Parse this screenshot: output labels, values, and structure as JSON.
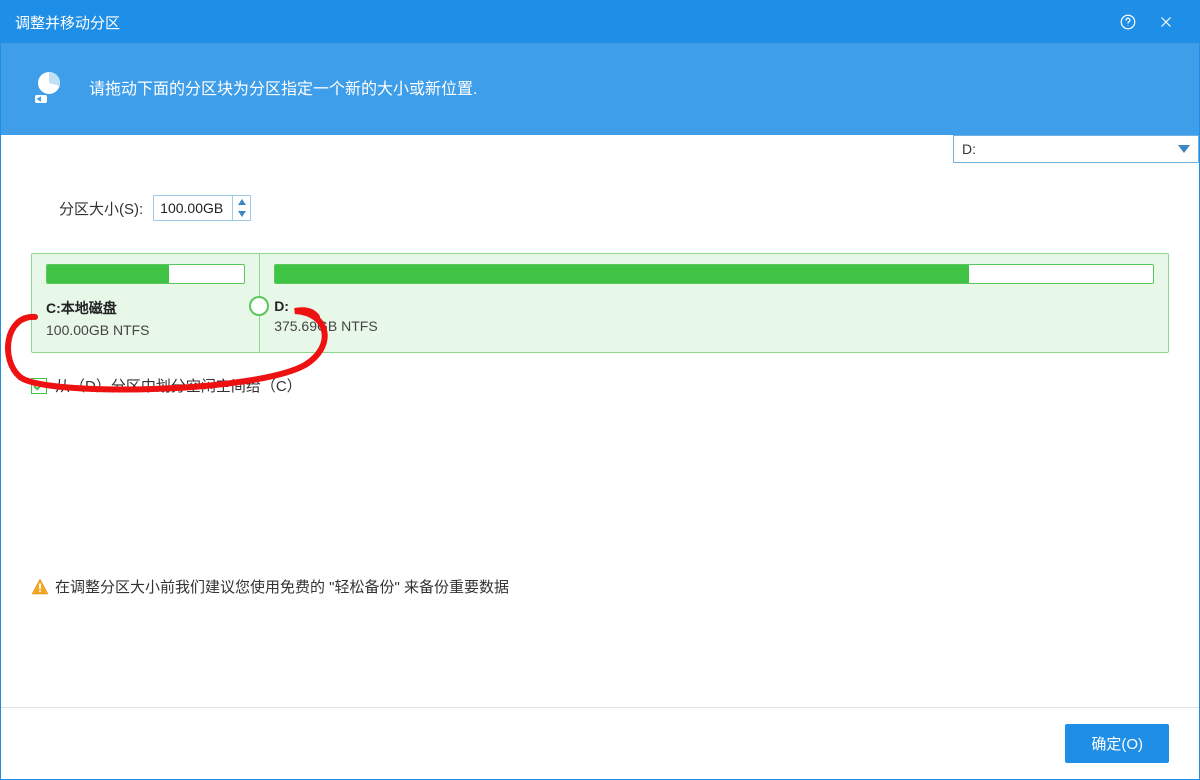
{
  "titlebar": {
    "title": "调整并移动分区"
  },
  "banner": {
    "text": "请拖动下面的分区块为分区指定一个新的大小或新位置."
  },
  "size": {
    "label": "分区大小(S):",
    "value": "100.00GB"
  },
  "partitions": [
    {
      "name": "C:本地磁盘",
      "info": "100.00GB NTFS",
      "width_pct": 20,
      "usage_pct": 62
    },
    {
      "name": "D:",
      "info": "375.69GB NTFS",
      "width_pct": 80,
      "usage_pct": 79
    }
  ],
  "handle_left_pct": 20,
  "checkbox": {
    "checked": true,
    "label": "从（D）分区中划分空闲空间给（C）"
  },
  "drive_select": {
    "value": "D:"
  },
  "warning": {
    "text": "在调整分区大小前我们建议您使用免费的 \"轻松备份\" 来备份重要数据"
  },
  "footer": {
    "ok_label": "确定(O)"
  }
}
